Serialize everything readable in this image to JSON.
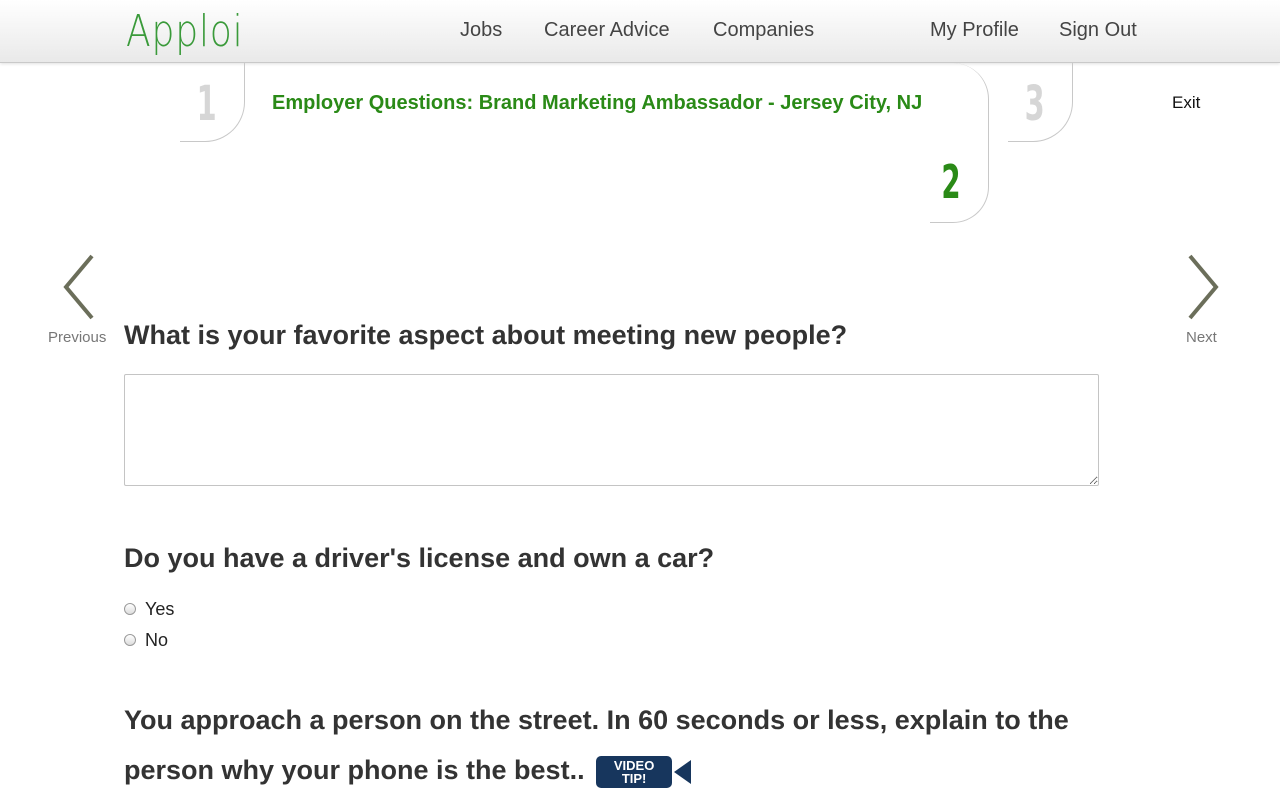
{
  "colors": {
    "brand_green": "#2a8a17",
    "logo_green": "#3a9a3a",
    "step_inactive": "#d6d6d6",
    "chevron": "#6b6e5a",
    "video_badge_bg": "#17365d"
  },
  "nav": {
    "logo": "Apploi",
    "links": [
      "Jobs",
      "Career Advice",
      "Companies",
      "My Profile",
      "Sign Out"
    ]
  },
  "steps": {
    "step1": "1",
    "step2": "2",
    "step3": "3",
    "active_title": "Employer Questions: Brand Marketing Ambassador - Jersey City, NJ",
    "exit": "Exit"
  },
  "pager": {
    "previous": "Previous",
    "next": "Next"
  },
  "questions": {
    "q1": {
      "text": "What is your favorite aspect about meeting new people?",
      "answer": ""
    },
    "q2": {
      "text": "Do you have a driver's license and own a car?",
      "options": [
        "Yes",
        "No"
      ]
    },
    "q3": {
      "text": "You approach a person on the street. In 60 seconds or less, explain to the person why your phone is the best..",
      "video_tip_line1": "VIDEO",
      "video_tip_line2": "TIP!"
    }
  }
}
